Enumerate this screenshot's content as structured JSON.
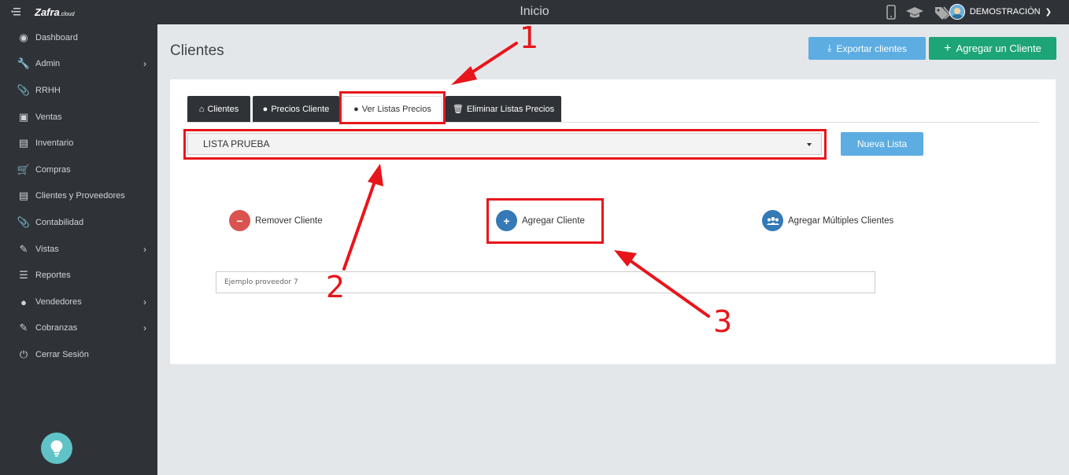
{
  "topbar": {
    "logo_text": "Zafra",
    "logo_suffix": ".cloud",
    "title": "Inicio",
    "user_name": "DEMOSTRACIÓN"
  },
  "sidebar": {
    "items": [
      {
        "label": "Dashboard",
        "icon": "dashboard-icon",
        "has_chevron": false
      },
      {
        "label": "Admin",
        "icon": "wrench-icon",
        "has_chevron": true
      },
      {
        "label": "RRHH",
        "icon": "paperclip-icon",
        "has_chevron": false
      },
      {
        "label": "Ventas",
        "icon": "money-icon",
        "has_chevron": false
      },
      {
        "label": "Inventario",
        "icon": "book-icon",
        "has_chevron": false
      },
      {
        "label": "Compras",
        "icon": "cart-icon",
        "has_chevron": false
      },
      {
        "label": "Clientes y Proveedores",
        "icon": "book-icon",
        "has_chevron": false
      },
      {
        "label": "Contabilidad",
        "icon": "paperclip-icon",
        "has_chevron": false
      },
      {
        "label": "Vistas",
        "icon": "edit-icon",
        "has_chevron": true
      },
      {
        "label": "Reportes",
        "icon": "list-icon",
        "has_chevron": false
      },
      {
        "label": "Vendedores",
        "icon": "user-icon",
        "has_chevron": true
      },
      {
        "label": "Cobranzas",
        "icon": "edit-icon",
        "has_chevron": true
      },
      {
        "label": "Cerrar Sesión",
        "icon": "power-icon",
        "has_chevron": false
      }
    ]
  },
  "page": {
    "title": "Clientes",
    "export_label": "Exportar clientes",
    "add_client_label": "Agregar un Cliente"
  },
  "tabs": [
    {
      "label": "Clientes",
      "icon": "home-icon"
    },
    {
      "label": "Precios Cliente",
      "icon": "user-icon"
    },
    {
      "label": "Ver Listas Precios",
      "icon": "user-icon",
      "active": true
    },
    {
      "label": "Eliminar Listas Precios",
      "icon": "trash-icon"
    }
  ],
  "price_list": {
    "selected": "LISTA PRUEBA",
    "new_list_label": "Nueva Lista"
  },
  "actions": {
    "remove_label": "Remover Cliente",
    "add_label": "Agregar Cliente",
    "add_multiple_label": "Agregar Múltiples Clientes"
  },
  "search": {
    "value": "Ejemplo proveedor 7"
  },
  "annotations": {
    "n1": "1",
    "n2": "2",
    "n3": "3",
    "color": "#e8151b"
  },
  "colors": {
    "dark": "#2f3338",
    "blue": "#5dade2",
    "green": "#1da477",
    "red_circle": "#d9534f",
    "blue_circle": "#337ab7"
  }
}
